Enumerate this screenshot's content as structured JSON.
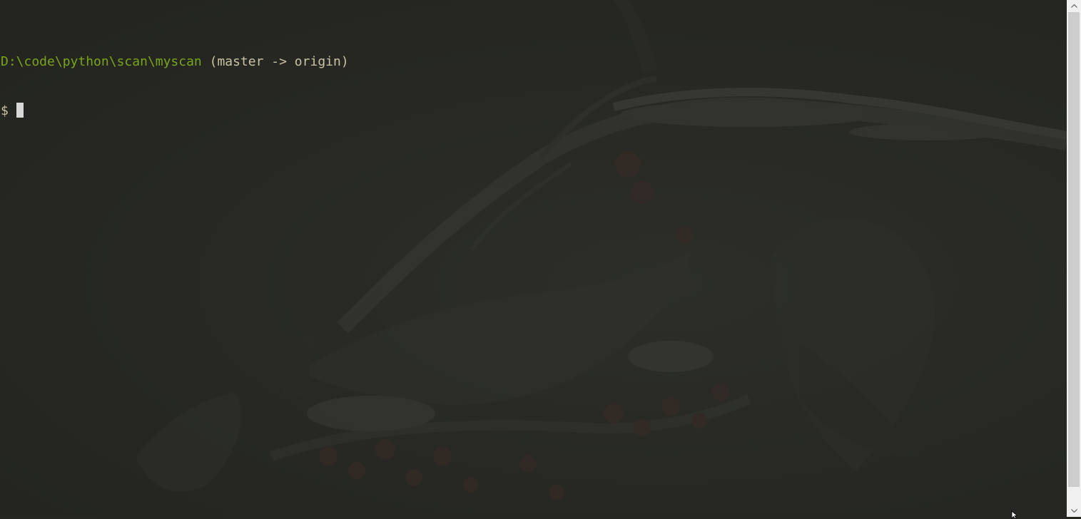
{
  "terminal": {
    "prompt_path": "D:\\code\\python\\scan\\myscan",
    "prompt_branch": " (master -> origin)",
    "prompt_symbol": "$",
    "input_value": ""
  },
  "colors": {
    "background": "#262722",
    "path": "#7aa51a",
    "branch": "#c9c2a3",
    "cursor": "#d8d8d8",
    "scrollbar_track": "#f0f0f0",
    "scrollbar_thumb": "#cdcdcd"
  },
  "scrollbar": {
    "position": 1.0,
    "up_icon": "arrow-up-icon",
    "down_icon": "arrow-down-icon"
  },
  "icons": {
    "mouse_pointer": "mouse-pointer-icon"
  }
}
